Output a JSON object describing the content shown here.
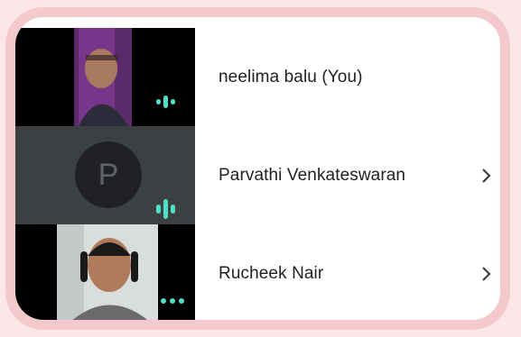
{
  "participants": [
    {
      "name": "neelima balu (You)",
      "video": "camera-on",
      "audio": "speaking-indicator",
      "has_chevron": false
    },
    {
      "name": "Parvathi Venkateswaran",
      "avatar_letter": "P",
      "video": "camera-off",
      "audio": "speaking-indicator",
      "has_chevron": true
    },
    {
      "name": "Rucheek Nair",
      "video": "camera-on",
      "audio": "idle-indicator",
      "has_chevron": true
    }
  ],
  "colors": {
    "accent": "#4de0c4",
    "frame": "#f4c9cc",
    "tile_off": "#3c4043"
  }
}
